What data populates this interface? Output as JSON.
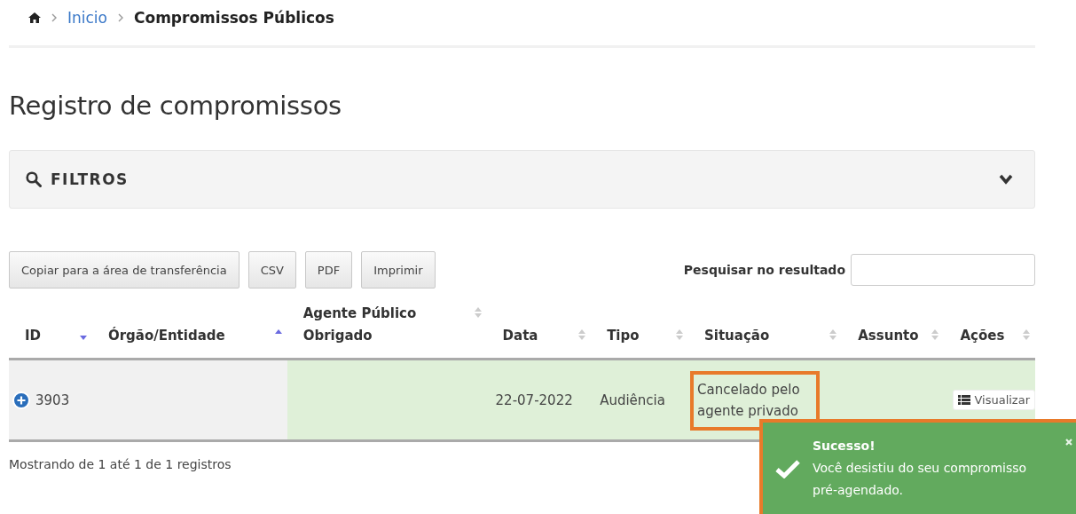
{
  "breadcrumb": [
    {
      "label": "Inicio",
      "kind": "link"
    },
    {
      "label": "Compromissos Públicos",
      "kind": "current"
    }
  ],
  "heading": "Registro de compromissos",
  "filters": {
    "label": "FILTROS",
    "expanded": false
  },
  "export_buttons": [
    "Copiar para a área de transferência",
    "CSV",
    "PDF",
    "Imprimir"
  ],
  "search": {
    "label": "Pesquisar no resultado"
  },
  "table": {
    "columns": [
      {
        "label": "ID",
        "sorted_up": false,
        "sorted_down": true
      },
      {
        "label": "Órgão/Entidade",
        "sorted_up": true,
        "sorted_down": false
      },
      {
        "label": "Agente Público Obrigado",
        "sorted_up": false,
        "sorted_down": false
      },
      {
        "label": "Data",
        "sorted_up": false,
        "sorted_down": false
      },
      {
        "label": "Tipo",
        "sorted_up": false,
        "sorted_down": false
      },
      {
        "label": "Situação",
        "sorted_up": false,
        "sorted_down": false
      },
      {
        "label": "Assunto",
        "sorted_up": false,
        "sorted_down": false
      },
      {
        "label": "Ações",
        "sorted_up": false,
        "sorted_down": false
      }
    ],
    "rows": [
      {
        "id": "3903",
        "data": "22-07-2022",
        "tipo": "Audiência",
        "situacao": "Cancelado pelo agente privado",
        "situacao_highlighted": true,
        "action": "Visualizar"
      }
    ]
  },
  "info": "Mostrando de 1 até 1 de 1 registros",
  "toast": {
    "title": "Sucesso!",
    "message": "Você desistiu do seu compromisso pré-agendado.",
    "highlighted": true
  }
}
